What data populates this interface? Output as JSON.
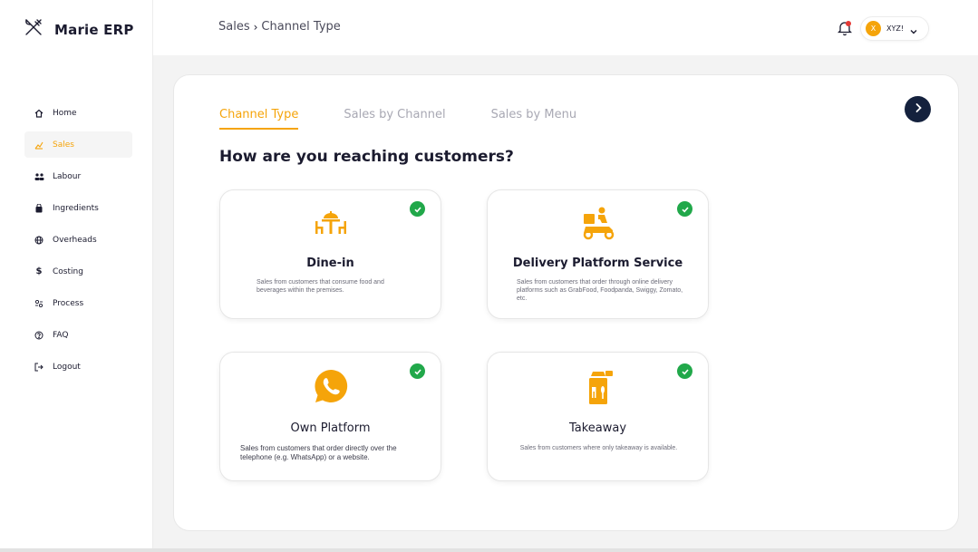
{
  "app": {
    "name": "Marie ERP"
  },
  "sidebar": {
    "items": [
      {
        "label": "Home",
        "icon": "home-icon"
      },
      {
        "label": "Sales",
        "icon": "chart-icon"
      },
      {
        "label": "Labour",
        "icon": "people-icon"
      },
      {
        "label": "Ingredients",
        "icon": "bag-icon"
      },
      {
        "label": "Overheads",
        "icon": "globe-icon"
      },
      {
        "label": "Costing",
        "icon": "dollar-icon"
      },
      {
        "label": "Process",
        "icon": "process-icon"
      },
      {
        "label": "FAQ",
        "icon": "question-icon"
      },
      {
        "label": "Logout",
        "icon": "logout-icon"
      }
    ],
    "active": "Sales"
  },
  "header": {
    "breadcrumb": {
      "parent": "Sales",
      "separator": "›",
      "current": "Channel Type"
    },
    "user": {
      "initial": "X",
      "name": "XYZ!"
    }
  },
  "tabs": [
    {
      "label": "Channel Type",
      "active": true
    },
    {
      "label": "Sales by Channel",
      "active": false
    },
    {
      "label": "Sales by Menu",
      "active": false
    }
  ],
  "question": "How are you reaching customers?",
  "channels": [
    {
      "title": "Dine-in",
      "description": "Sales from customers that consume food and beverages within the premises.",
      "icon": "dine-in-icon",
      "selected": true
    },
    {
      "title": "Delivery Platform Service",
      "description": "Sales from customers that order through online delivery platforms such as GrabFood, Foodpanda, Swiggy, Zomato, etc.",
      "icon": "delivery-scooter-icon",
      "selected": true
    },
    {
      "title": "Own Platform",
      "description": "Sales from customers that order directly over the telephone (e.g. WhatsApp) or a website.",
      "icon": "whatsapp-phone-icon",
      "selected": true
    },
    {
      "title": "Takeaway",
      "description": "Sales from customers where only takeaway is available.",
      "icon": "takeaway-bag-icon",
      "selected": true
    }
  ],
  "colors": {
    "accent": "#f5a40a",
    "dark": "#14213d",
    "check": "#21a84a",
    "notification": "#e53935"
  }
}
